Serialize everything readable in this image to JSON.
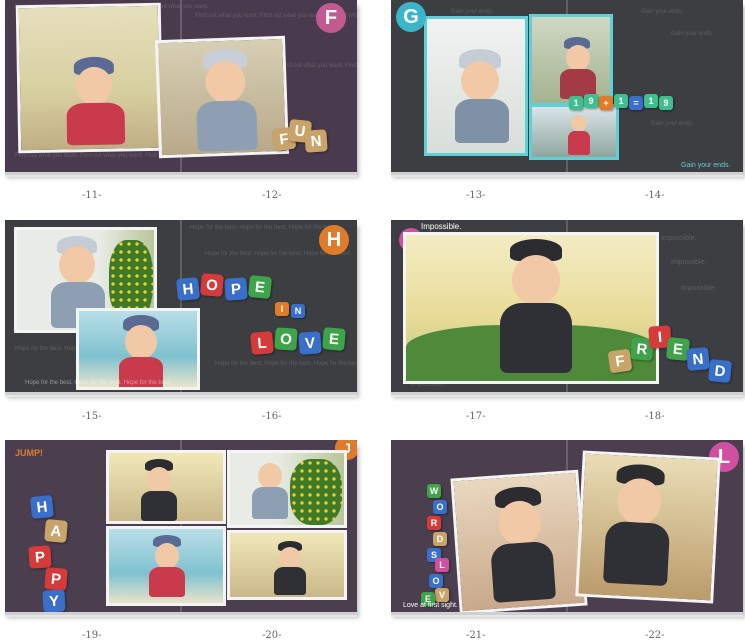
{
  "spreads": [
    {
      "badge": "F",
      "badge_color": "#c05a8f",
      "bg_text": "Find out what you want. Find out what you want. Find out what you want.",
      "word": [
        "F",
        "U",
        "N"
      ],
      "word_color": "#c9b27a",
      "pages": [
        "-11-",
        "-12-"
      ]
    },
    {
      "badge": "G",
      "badge_color": "#3ab5c9",
      "bg_text": "Gain your ends.",
      "equation": [
        "1",
        "9",
        "+",
        "1",
        "=",
        "1",
        "9"
      ],
      "equation_color": "#3fbf8f",
      "caption": "Gain your ends.",
      "caption_color": "#5fd0d6",
      "pages": [
        "-13-",
        "-14-"
      ]
    },
    {
      "badge": "H",
      "badge_color": "#e07b2a",
      "bg_text": "Hope for the best. Hope for the best. Hope for the best.",
      "word_hope": [
        "H",
        "O",
        "P",
        "E"
      ],
      "word_in": [
        "I",
        "N"
      ],
      "word_love": [
        "L",
        "O",
        "V",
        "E"
      ],
      "caption": "Hope for the best.   Hope for the best.   Hope for the best.",
      "pages": [
        "-15-",
        "-16-"
      ]
    },
    {
      "badge": "I",
      "badge_color": "#d14fa0",
      "bg_text": "Impossible.",
      "top_caption": "Impossible.",
      "word": [
        "F",
        "R",
        "I",
        "E",
        "N",
        "D"
      ],
      "pages": [
        "-17-",
        "-18-"
      ]
    },
    {
      "badge": "J",
      "badge_color": "#e07b2a",
      "title": "JUMP!",
      "title_color": "#e07b2a",
      "word": [
        "H",
        "A",
        "P",
        "P",
        "Y"
      ],
      "pages": [
        "-19-",
        "-20-"
      ]
    },
    {
      "badge": "L",
      "badge_color": "#d14fa0",
      "word_words": [
        "W",
        "O",
        "R",
        "D",
        "S"
      ],
      "word_love": [
        "L",
        "O",
        "V",
        "E"
      ],
      "caption": "Love at first sight.",
      "pages": [
        "-21-",
        "-22-"
      ]
    }
  ],
  "colors": {
    "red": "#d63b3b",
    "blue": "#3a6fc9",
    "green": "#3fa34a",
    "orange": "#e07b2a",
    "pink": "#d14fa0",
    "tan": "#c9a46a",
    "teal": "#3ab5c9"
  }
}
